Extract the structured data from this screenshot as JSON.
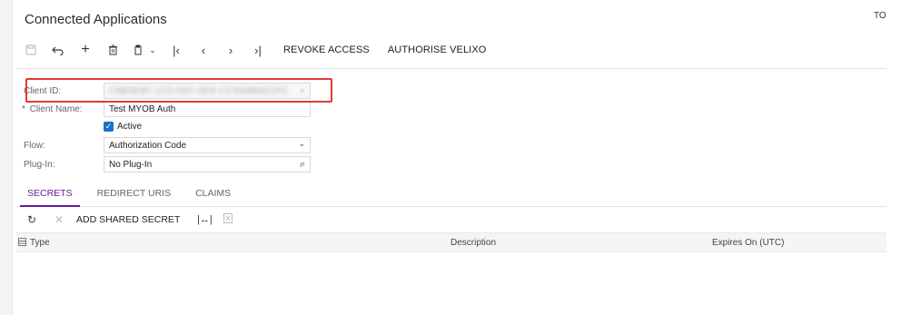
{
  "page": {
    "title": "Connected Applications",
    "user_label": "TO"
  },
  "toolbar": {
    "icons": [
      "save-icon",
      "undo-icon",
      "add-icon",
      "delete-icon",
      "copy-paste-icon",
      "first-icon",
      "previous-icon",
      "next-icon",
      "last-icon"
    ],
    "revoke_label": "REVOKE ACCESS",
    "authorise_label": "AUTHORISE VELIXO"
  },
  "form": {
    "client_id": {
      "label": "Client ID:",
      "value": "C8B9E8F-1C0-0EF-9E8-CC5D8B9D1F0"
    },
    "client_name": {
      "label": "Client Name:",
      "required_marker": "*",
      "value": "Test MYOB Auth"
    },
    "active": {
      "label": "Active",
      "checked": true
    },
    "flow": {
      "label": "Flow:",
      "value": "Authorization Code"
    },
    "plugin": {
      "label": "Plug-In:",
      "value": "No Plug-In"
    }
  },
  "tabs": [
    {
      "label": "SECRETS",
      "active": true
    },
    {
      "label": "REDIRECT URIS",
      "active": false
    },
    {
      "label": "CLAIMS",
      "active": false
    }
  ],
  "grid": {
    "add_shared_secret_label": "ADD SHARED SECRET",
    "columns": [
      "Type",
      "Description",
      "Expires On (UTC)"
    ]
  },
  "colors": {
    "accent": "#6a1b9a",
    "highlight": "#e53935",
    "checkbox": "#1a73c8"
  }
}
